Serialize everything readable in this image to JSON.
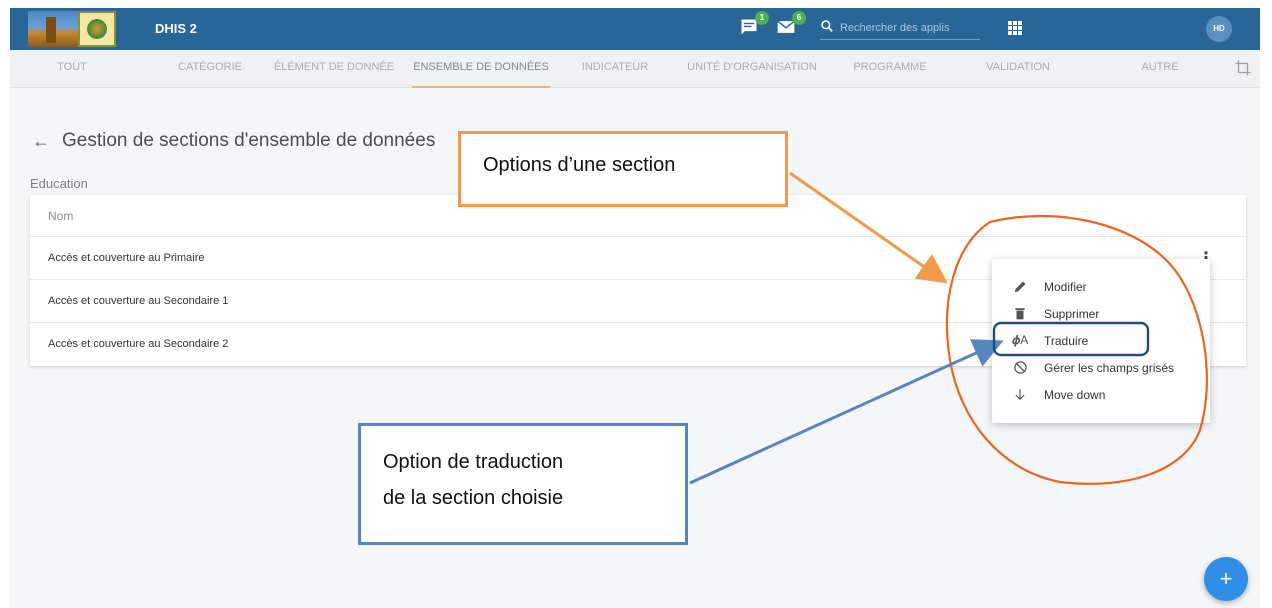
{
  "header": {
    "app_name": "DHIS 2",
    "messages_badge": "1",
    "interpretations_badge": "6",
    "search_placeholder": "Rechercher des applis",
    "avatar_initials": "HD"
  },
  "tabs": [
    {
      "label": "TOUT"
    },
    {
      "label": "CATÉGORIE"
    },
    {
      "label": "ÉLÉMENT DE DONNÉE"
    },
    {
      "label": "ENSEMBLE DE DONNÉES"
    },
    {
      "label": "INDICATEUR"
    },
    {
      "label": "UNITÉ D'ORGANISATION"
    },
    {
      "label": "PROGRAMME"
    },
    {
      "label": "VALIDATION"
    },
    {
      "label": "AUTRE"
    }
  ],
  "active_tab": "ENSEMBLE DE DONNÉES",
  "page": {
    "title": "Gestion de sections d'ensemble de données",
    "section_label": "Education"
  },
  "table": {
    "header": "Nom",
    "rows": [
      {
        "name": "Accès et couverture au Primaire"
      },
      {
        "name": "Accès et couverture au Secondaire 1"
      },
      {
        "name": "Accès et couverture au Secondaire 2"
      }
    ]
  },
  "context_menu": {
    "items": [
      {
        "label": "Modifier",
        "icon": "pencil-icon"
      },
      {
        "label": "Supprimer",
        "icon": "trash-icon"
      },
      {
        "label": "Traduire",
        "icon": "translate-icon"
      },
      {
        "label": "Gérer les champs grisés",
        "icon": "block-icon"
      },
      {
        "label": "Move down",
        "icon": "arrow-down-icon"
      }
    ]
  },
  "fab": {
    "label": "+"
  },
  "annotations": {
    "callout_top": "Options d’une section",
    "callout_bottom_line1": "Option de traduction",
    "callout_bottom_line2": "de la section choisie"
  },
  "colors": {
    "header_bg": "#276696",
    "tab_active_underline": "#f3b56b",
    "fab_bg": "#2f8ee6",
    "callout_orange": "#f2994a",
    "callout_blue": "#5a86c0",
    "circle_orange": "#e8661e",
    "highlight_navy": "#1d4e7a"
  }
}
